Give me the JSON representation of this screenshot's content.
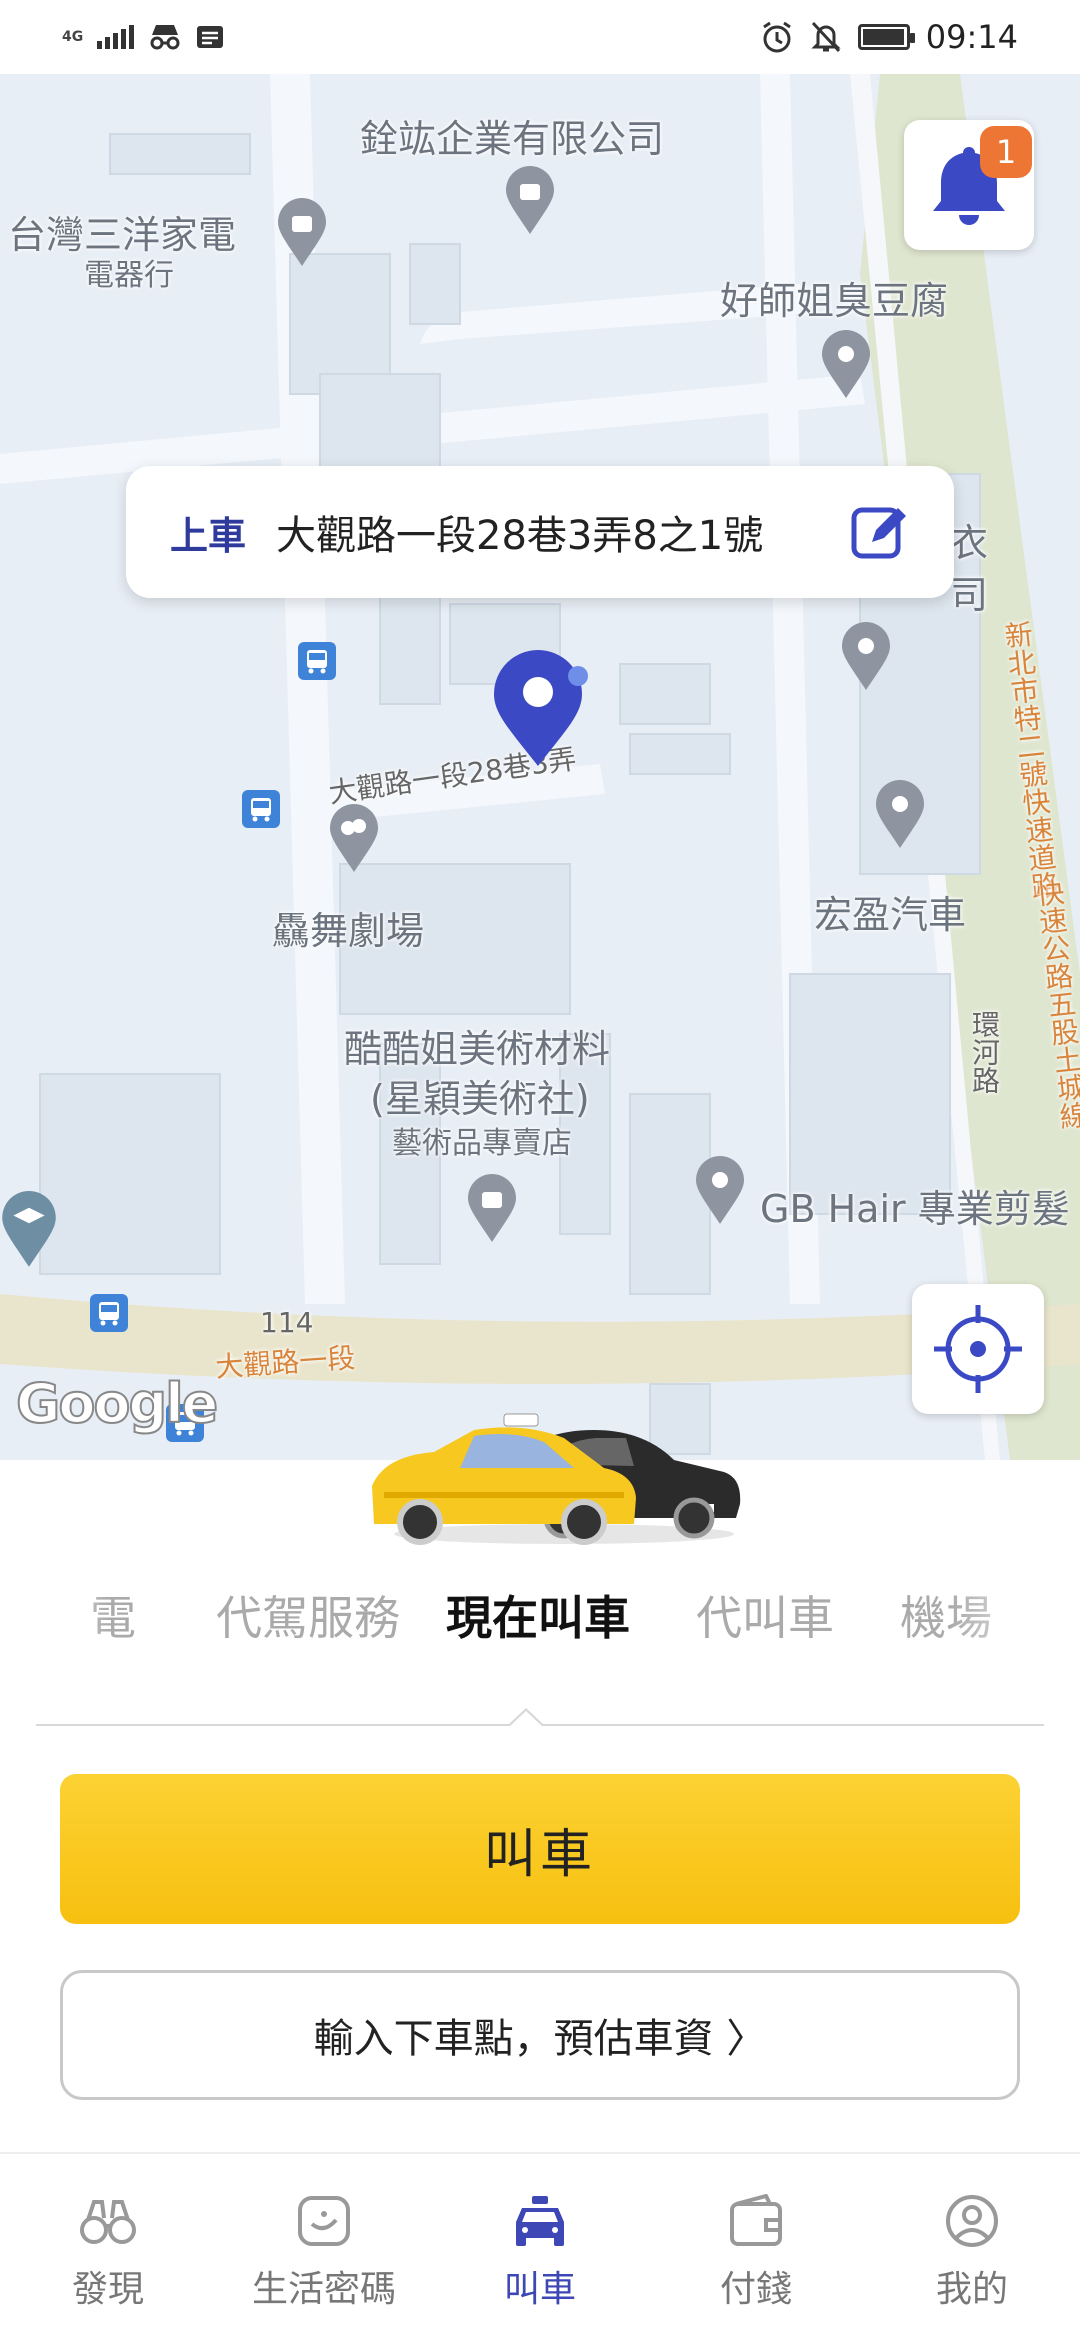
{
  "status_bar": {
    "network": "4G",
    "time": "09:14",
    "battery_level": 0.9
  },
  "map": {
    "labels": {
      "company_top": "銓竑企業有限公司",
      "appliance": "台灣三洋家電",
      "appliance_sub": "電器行",
      "tofu": "好師姐臭豆腐",
      "right_partial": "衣",
      "right_partial2": "司",
      "lane_road": "大觀路一段28巷3弄",
      "theater": "驫舞劇場",
      "car_dealer": "宏盈汽車",
      "art_supply_1": "酷酷姐美術材料",
      "art_supply_2": "(星穎美術社)",
      "art_supply_sub": "藝術品專賣店",
      "hair": "GB Hair 專業剪髮",
      "route_114": "114",
      "main_road": "大觀路一段",
      "ring_road": "環河路",
      "expressway_1": "新北市特二號快速道路",
      "expressway_2": "快速公路五股土城線",
      "google": "Google"
    },
    "notification_count": "1",
    "pickup": {
      "tag": "上車",
      "address": "大觀路一段28巷3弄8之1號"
    }
  },
  "service_tabs": [
    "電",
    "代駕服務",
    "現在叫車",
    "代叫車",
    "機場"
  ],
  "active_tab": "現在叫車",
  "buttons": {
    "call": "叫車",
    "destination": "輸入下車點，預估車資 〉"
  },
  "nav": [
    {
      "label": "發現",
      "icon": "binoculars-icon"
    },
    {
      "label": "生活密碼",
      "icon": "life-code-icon"
    },
    {
      "label": "叫車",
      "icon": "taxi-icon"
    },
    {
      "label": "付錢",
      "icon": "wallet-icon"
    },
    {
      "label": "我的",
      "icon": "profile-icon"
    }
  ],
  "colors": {
    "accent": "#3d47b5",
    "yellow": "#fcd233",
    "badge": "#ee7634"
  }
}
